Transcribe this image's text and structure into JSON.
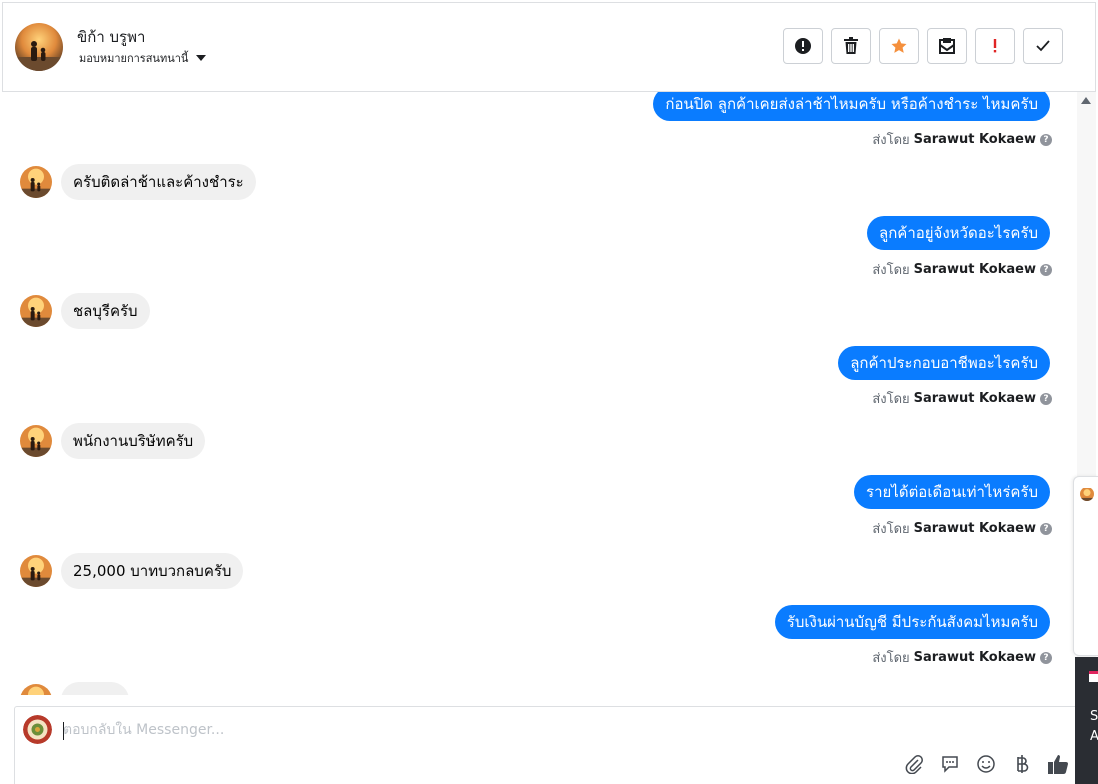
{
  "header": {
    "contact_name": "ขิก้า บรูพา",
    "assign_label": "มอบหมายการสนทนานี้",
    "actions": [
      {
        "name": "spam-button",
        "icon": "alert-circle-icon"
      },
      {
        "name": "delete-button",
        "icon": "trash-icon"
      },
      {
        "name": "star-button",
        "icon": "star-icon",
        "color": "#f5903d"
      },
      {
        "name": "mark-unread-button",
        "icon": "envelope-open-icon"
      },
      {
        "name": "flag-button",
        "icon": "exclamation-icon",
        "color": "#e02525"
      },
      {
        "name": "done-button",
        "icon": "check-icon"
      }
    ]
  },
  "thread": {
    "sent_prefix": "ส่งโดย",
    "agent_name": "Sarawut Kokaew",
    "messages": [
      {
        "dir": "out",
        "text": "ก่อนปิด ลูกค้าเคยส่งล่าช้าไหมครับ  หรือค้างชำระ ไหมครับ"
      },
      {
        "dir": "in",
        "text": "ครับติดล่าช้าและค้างชำระ"
      },
      {
        "dir": "out",
        "text": "ลูกค้าอยู่จังหวัดอะไรครับ"
      },
      {
        "dir": "in",
        "text": "ชลบุรีครับ"
      },
      {
        "dir": "out",
        "text": "ลูกค้าประกอบอาชีพอะไรครับ"
      },
      {
        "dir": "in",
        "text": "พนักงานบริษัทครับ"
      },
      {
        "dir": "out",
        "text": "รายได้ต่อเดือนเท่าไหร่ครับ"
      },
      {
        "dir": "in",
        "text": "25,000 บาทบวกลบครับ"
      },
      {
        "dir": "out",
        "text": "รับเงินผ่านบัญชี มีประกันสังคมไหมครับ"
      }
    ]
  },
  "composer": {
    "placeholder": "ตอบกลับใน Messenger...",
    "icons": [
      "paperclip-icon",
      "saved-reply-icon",
      "emoji-icon",
      "baht-icon",
      "thumbs-up-icon"
    ]
  },
  "side_panel": {
    "text_lines": [
      "S",
      "A"
    ]
  },
  "colors": {
    "accent": "#0a7cff",
    "incoming_bubble": "#f0f0f0"
  }
}
